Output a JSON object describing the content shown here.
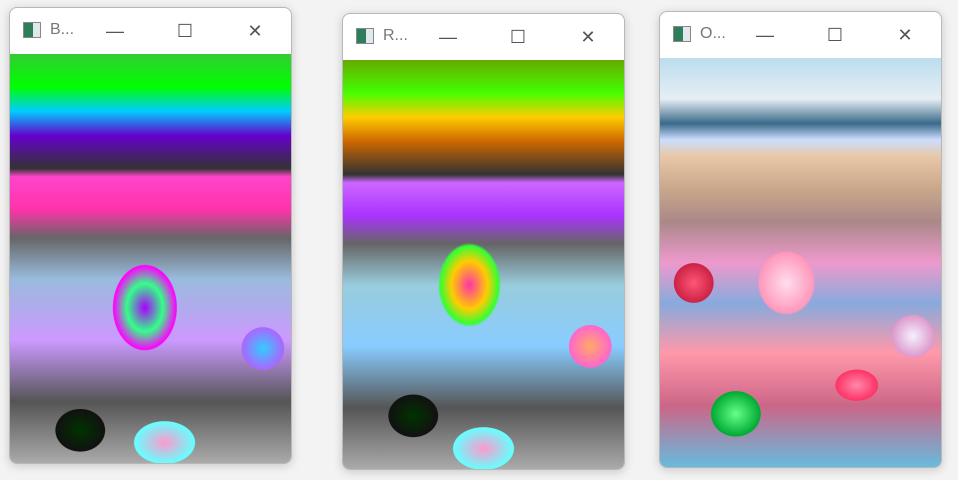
{
  "windows": [
    {
      "title": "B...",
      "icon": "opencv-window-icon",
      "controls": [
        "minimize",
        "maximize",
        "close"
      ]
    },
    {
      "title": "R...",
      "icon": "opencv-window-icon",
      "controls": [
        "minimize",
        "maximize",
        "close"
      ]
    },
    {
      "title": "O...",
      "icon": "opencv-window-icon",
      "controls": [
        "minimize",
        "maximize",
        "close"
      ]
    }
  ],
  "glyphs": {
    "minimize": "—",
    "maximize": "☐",
    "close": "✕"
  }
}
